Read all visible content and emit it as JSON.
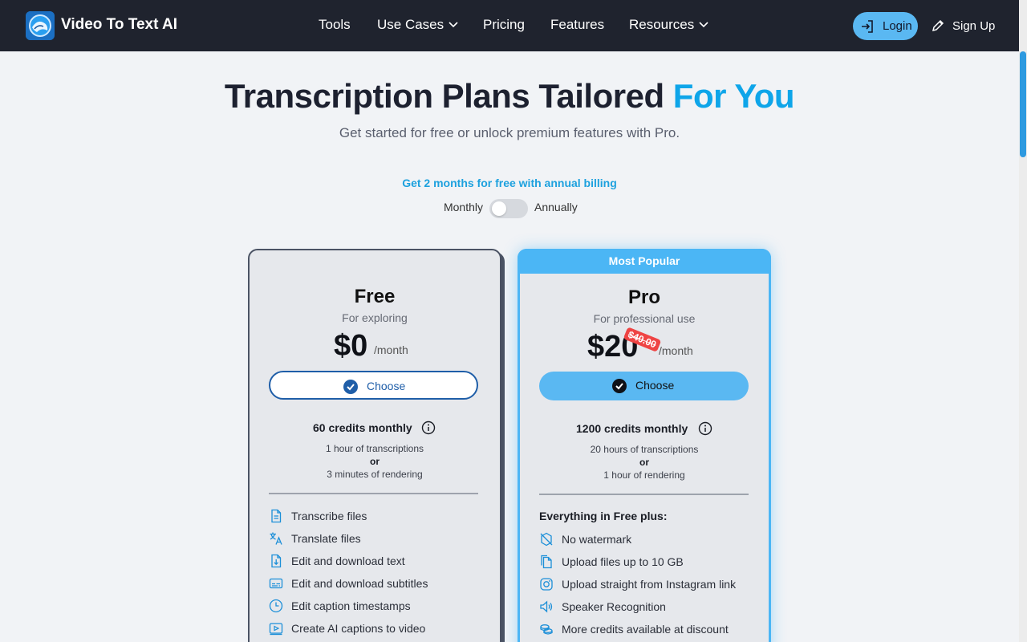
{
  "header": {
    "brand": "Video To Text AI",
    "nav": [
      {
        "label": "Tools"
      },
      {
        "label": "Use Cases"
      },
      {
        "label": "Pricing"
      },
      {
        "label": "Features"
      },
      {
        "label": "Resources"
      }
    ],
    "login_label": "Login",
    "signup_label": "Sign Up"
  },
  "hero": {
    "title_main": "Transcription Plans Tailored",
    "title_accent": "For You",
    "subtitle": "Get started for free or unlock premium features with Pro."
  },
  "billing": {
    "promo": "Get 2 months for free with annual billing",
    "monthly_label": "Monthly",
    "annually_label": "Annually",
    "annual_enabled": false
  },
  "plans": {
    "free": {
      "name": "Free",
      "description": "For exploring",
      "price": "$0",
      "period": "/month",
      "choose_label": "Choose",
      "credits": "60 credits monthly",
      "detail_1": "1 hour of transcriptions",
      "detail_or": "or",
      "detail_2": "3 minutes of rendering",
      "features": [
        {
          "label": "Transcribe files",
          "icon": "document-icon"
        },
        {
          "label": "Translate files",
          "icon": "translate-icon"
        },
        {
          "label": "Edit and download text",
          "icon": "download-file-icon"
        },
        {
          "label": "Edit and download subtitles",
          "icon": "subtitles-icon"
        },
        {
          "label": "Edit caption timestamps",
          "icon": "clock-icon"
        },
        {
          "label": "Create AI captions to video",
          "icon": "video-icon"
        }
      ]
    },
    "pro": {
      "badge": "Most Popular",
      "name": "Pro",
      "description": "For professional use",
      "old_price": "$40.00",
      "price": "$20",
      "period": "/month",
      "choose_label": "Choose",
      "credits": "1200 credits monthly",
      "detail_1": "20 hours of transcriptions",
      "detail_or": "or",
      "detail_2": "1 hour of rendering",
      "features_heading": "Everything in Free plus:",
      "features": [
        {
          "label": "No watermark",
          "icon": "no-watermark-icon"
        },
        {
          "label": "Upload files up to 10 GB",
          "icon": "files-icon"
        },
        {
          "label": "Upload straight from Instagram link",
          "icon": "instagram-icon"
        },
        {
          "label": "Speaker Recognition",
          "icon": "speaker-icon"
        },
        {
          "label": "More credits available at discount",
          "icon": "coins-icon"
        }
      ]
    }
  },
  "colors": {
    "header_bg": "#1f232e",
    "accent": "#0ea5e9",
    "pro_border": "#4bb6f5",
    "button_blue": "#5ab8f2",
    "discount_red": "#ef4444"
  }
}
